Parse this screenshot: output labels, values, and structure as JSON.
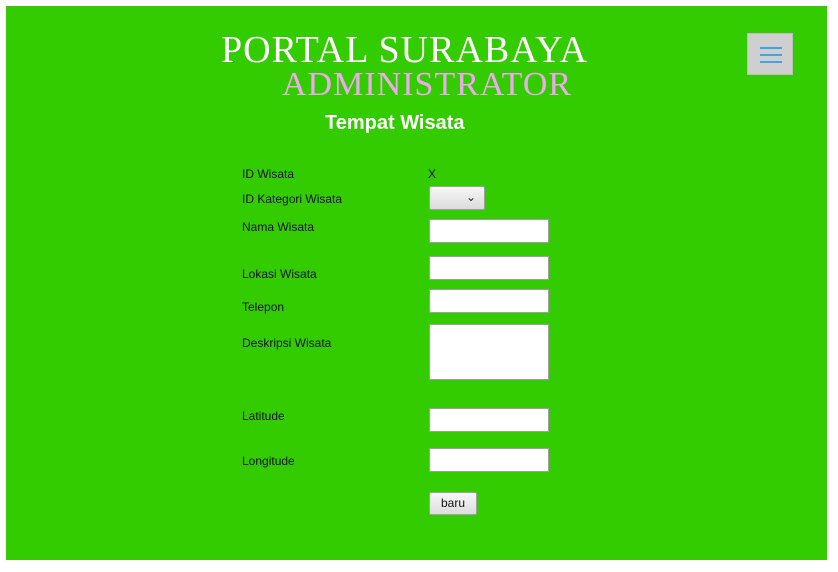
{
  "header": {
    "title": "PORTAL SURABAYA",
    "subtitle": "ADMINISTRATOR",
    "page_heading": "Tempat Wisata",
    "menu_icon": "hamburger-icon"
  },
  "form": {
    "id_wisata": {
      "label": "ID Wisata",
      "value": "X"
    },
    "id_kategori": {
      "label": "ID Kategori Wisata",
      "value": ""
    },
    "nama": {
      "label": "Nama Wisata",
      "value": ""
    },
    "lokasi": {
      "label": "Lokasi Wisata",
      "value": ""
    },
    "telepon": {
      "label": "Telepon",
      "value": ""
    },
    "deskripsi": {
      "label": "Deskripsi Wisata",
      "value": ""
    },
    "latitude": {
      "label": "Latitude",
      "value": ""
    },
    "longitude": {
      "label": "Longitude",
      "value": ""
    },
    "submit_label": "baru"
  },
  "colors": {
    "background": "#33cc00",
    "title": "#ffffff",
    "subtitle": "#f0a8f0",
    "menu_icon": "#3aa6e6"
  }
}
